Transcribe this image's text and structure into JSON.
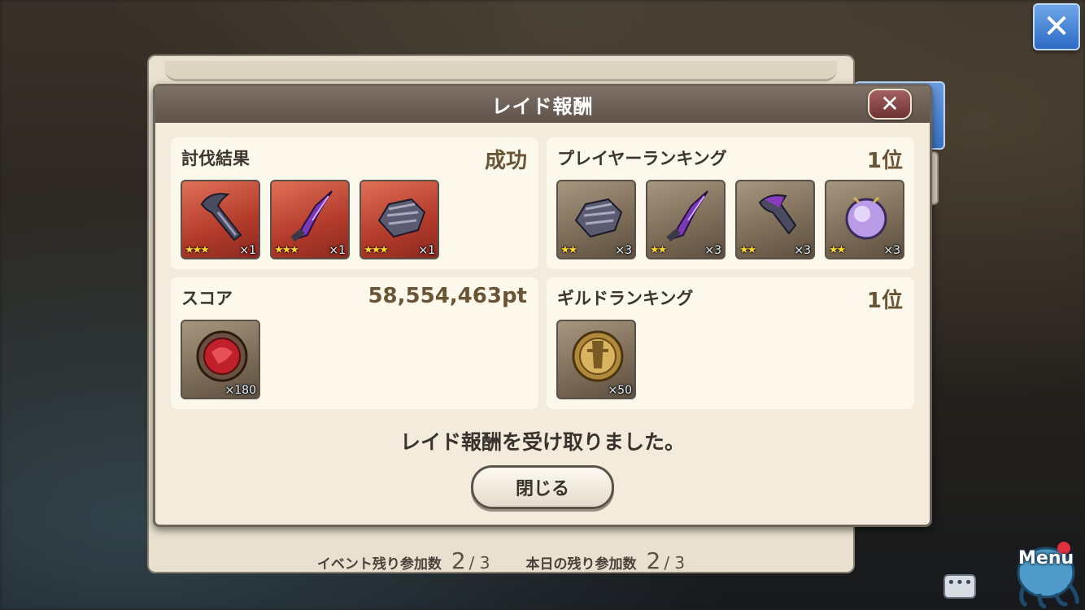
{
  "dialog": {
    "title": "レイド報酬",
    "message": "レイド報酬を受け取りました。",
    "close_button": "閉じる"
  },
  "sections": {
    "result": {
      "title": "討伐結果",
      "value": "成功",
      "items": [
        {
          "icon": "claw-weapon-icon",
          "stars": "★★★",
          "qty": "×1"
        },
        {
          "icon": "crystal-blade-icon",
          "stars": "★★★",
          "qty": "×1"
        },
        {
          "icon": "gauntlet-icon",
          "stars": "★★★",
          "qty": "×1"
        }
      ]
    },
    "player_ranking": {
      "title": "プレイヤーランキング",
      "value": "1位",
      "items": [
        {
          "icon": "gauntlet-icon",
          "stars": "★★",
          "qty": "×3"
        },
        {
          "icon": "crystal-blade-icon",
          "stars": "★★",
          "qty": "×3"
        },
        {
          "icon": "claw-weapon-icon",
          "stars": "★★",
          "qty": "×3"
        },
        {
          "icon": "orb-icon",
          "stars": "★★",
          "qty": "×3"
        }
      ]
    },
    "score": {
      "title": "スコア",
      "value": "58,554,463pt",
      "items": [
        {
          "icon": "red-medal-icon",
          "qty": "×180"
        }
      ]
    },
    "guild_ranking": {
      "title": "ギルドランキング",
      "value": "1位",
      "items": [
        {
          "icon": "gold-medal-icon",
          "qty": "×50"
        }
      ]
    }
  },
  "footer": {
    "event_label": "イベント残り参加数",
    "event_remaining": "2",
    "event_total": "/ 3",
    "daily_label": "本日の残り参加数",
    "daily_remaining": "2",
    "daily_total": "/ 3"
  },
  "hud": {
    "menu_label": "Menu"
  },
  "colors": {
    "red_frame": "#b23a2a",
    "tan_frame": "#7a6a56",
    "header": "#6f6258",
    "close_blue": "#2d6ac4"
  }
}
